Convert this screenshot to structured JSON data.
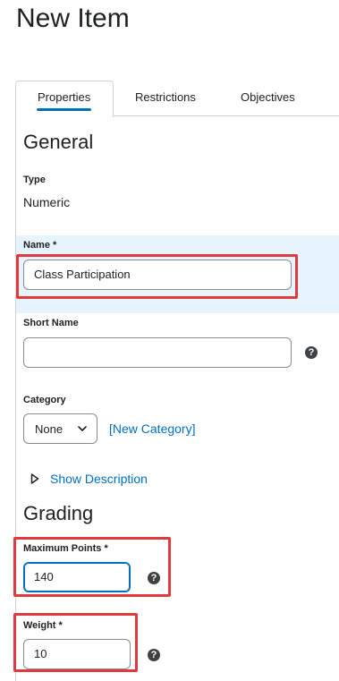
{
  "page": {
    "title": "New Item"
  },
  "tabs": [
    {
      "label": "Properties",
      "active": true
    },
    {
      "label": "Restrictions",
      "active": false
    },
    {
      "label": "Objectives",
      "active": false
    }
  ],
  "general": {
    "heading": "General",
    "type_label": "Type",
    "type_value": "Numeric",
    "name_label": "Name *",
    "name_value": "Class Participation",
    "short_name_label": "Short Name",
    "short_name_value": "",
    "category_label": "Category",
    "category_value": "None",
    "new_category_link": "[New Category]",
    "show_description": "Show Description"
  },
  "grading": {
    "heading": "Grading",
    "max_points_label": "Maximum Points *",
    "max_points_value": "140",
    "weight_label": "Weight *",
    "weight_value": "10"
  },
  "icons": {
    "help": "help-circle-icon",
    "chevron": "chevron-down-icon",
    "expand": "triangle-right-icon"
  },
  "colors": {
    "accent": "#006fbf",
    "highlight_border": "#e0393e",
    "name_row_bg": "#e8f4fd"
  }
}
